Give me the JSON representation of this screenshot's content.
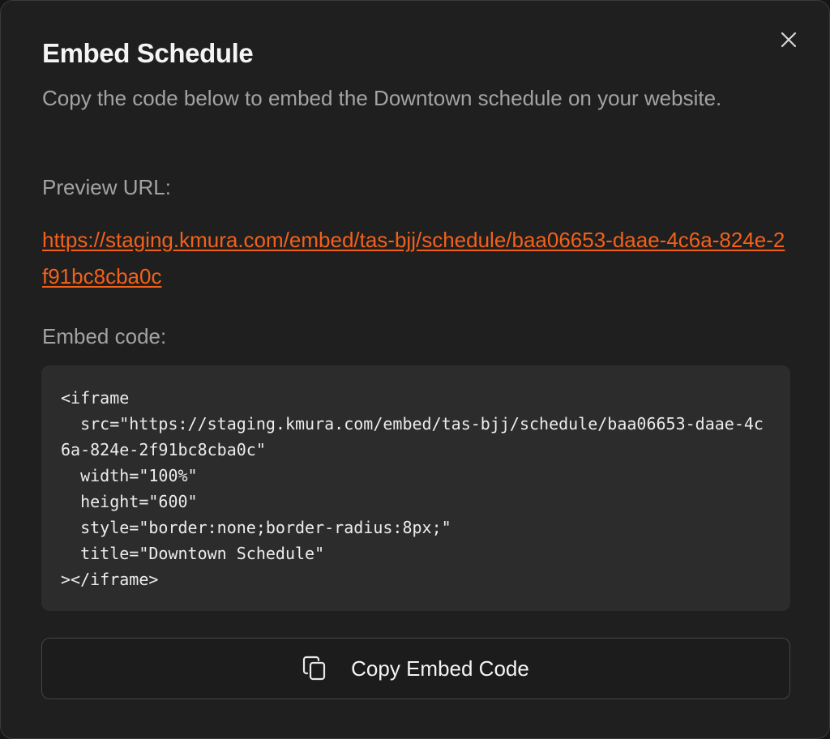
{
  "dialog": {
    "title": "Embed Schedule",
    "description": "Copy the code below to embed the Downtown schedule on your website.",
    "close_icon": "close-icon"
  },
  "preview": {
    "label": "Preview URL:",
    "url": "https://staging.kmura.com/embed/tas-bjj/schedule/baa06653-daae-4c6a-824e-2f91bc8cba0c"
  },
  "embed": {
    "label": "Embed code:",
    "code": "<iframe\n  src=\"https://staging.kmura.com/embed/tas-bjj/schedule/baa06653-daae-4c6a-824e-2f91bc8cba0c\"\n  width=\"100%\"\n  height=\"600\"\n  style=\"border:none;border-radius:8px;\"\n  title=\"Downtown Schedule\"\n></iframe>"
  },
  "copy_button": {
    "label": "Copy Embed Code",
    "icon": "copy-icon"
  },
  "colors": {
    "background": "#1f1f1f",
    "link": "#f2611b",
    "muted_text": "#a3a3a3",
    "code_background": "#2c2c2c"
  }
}
